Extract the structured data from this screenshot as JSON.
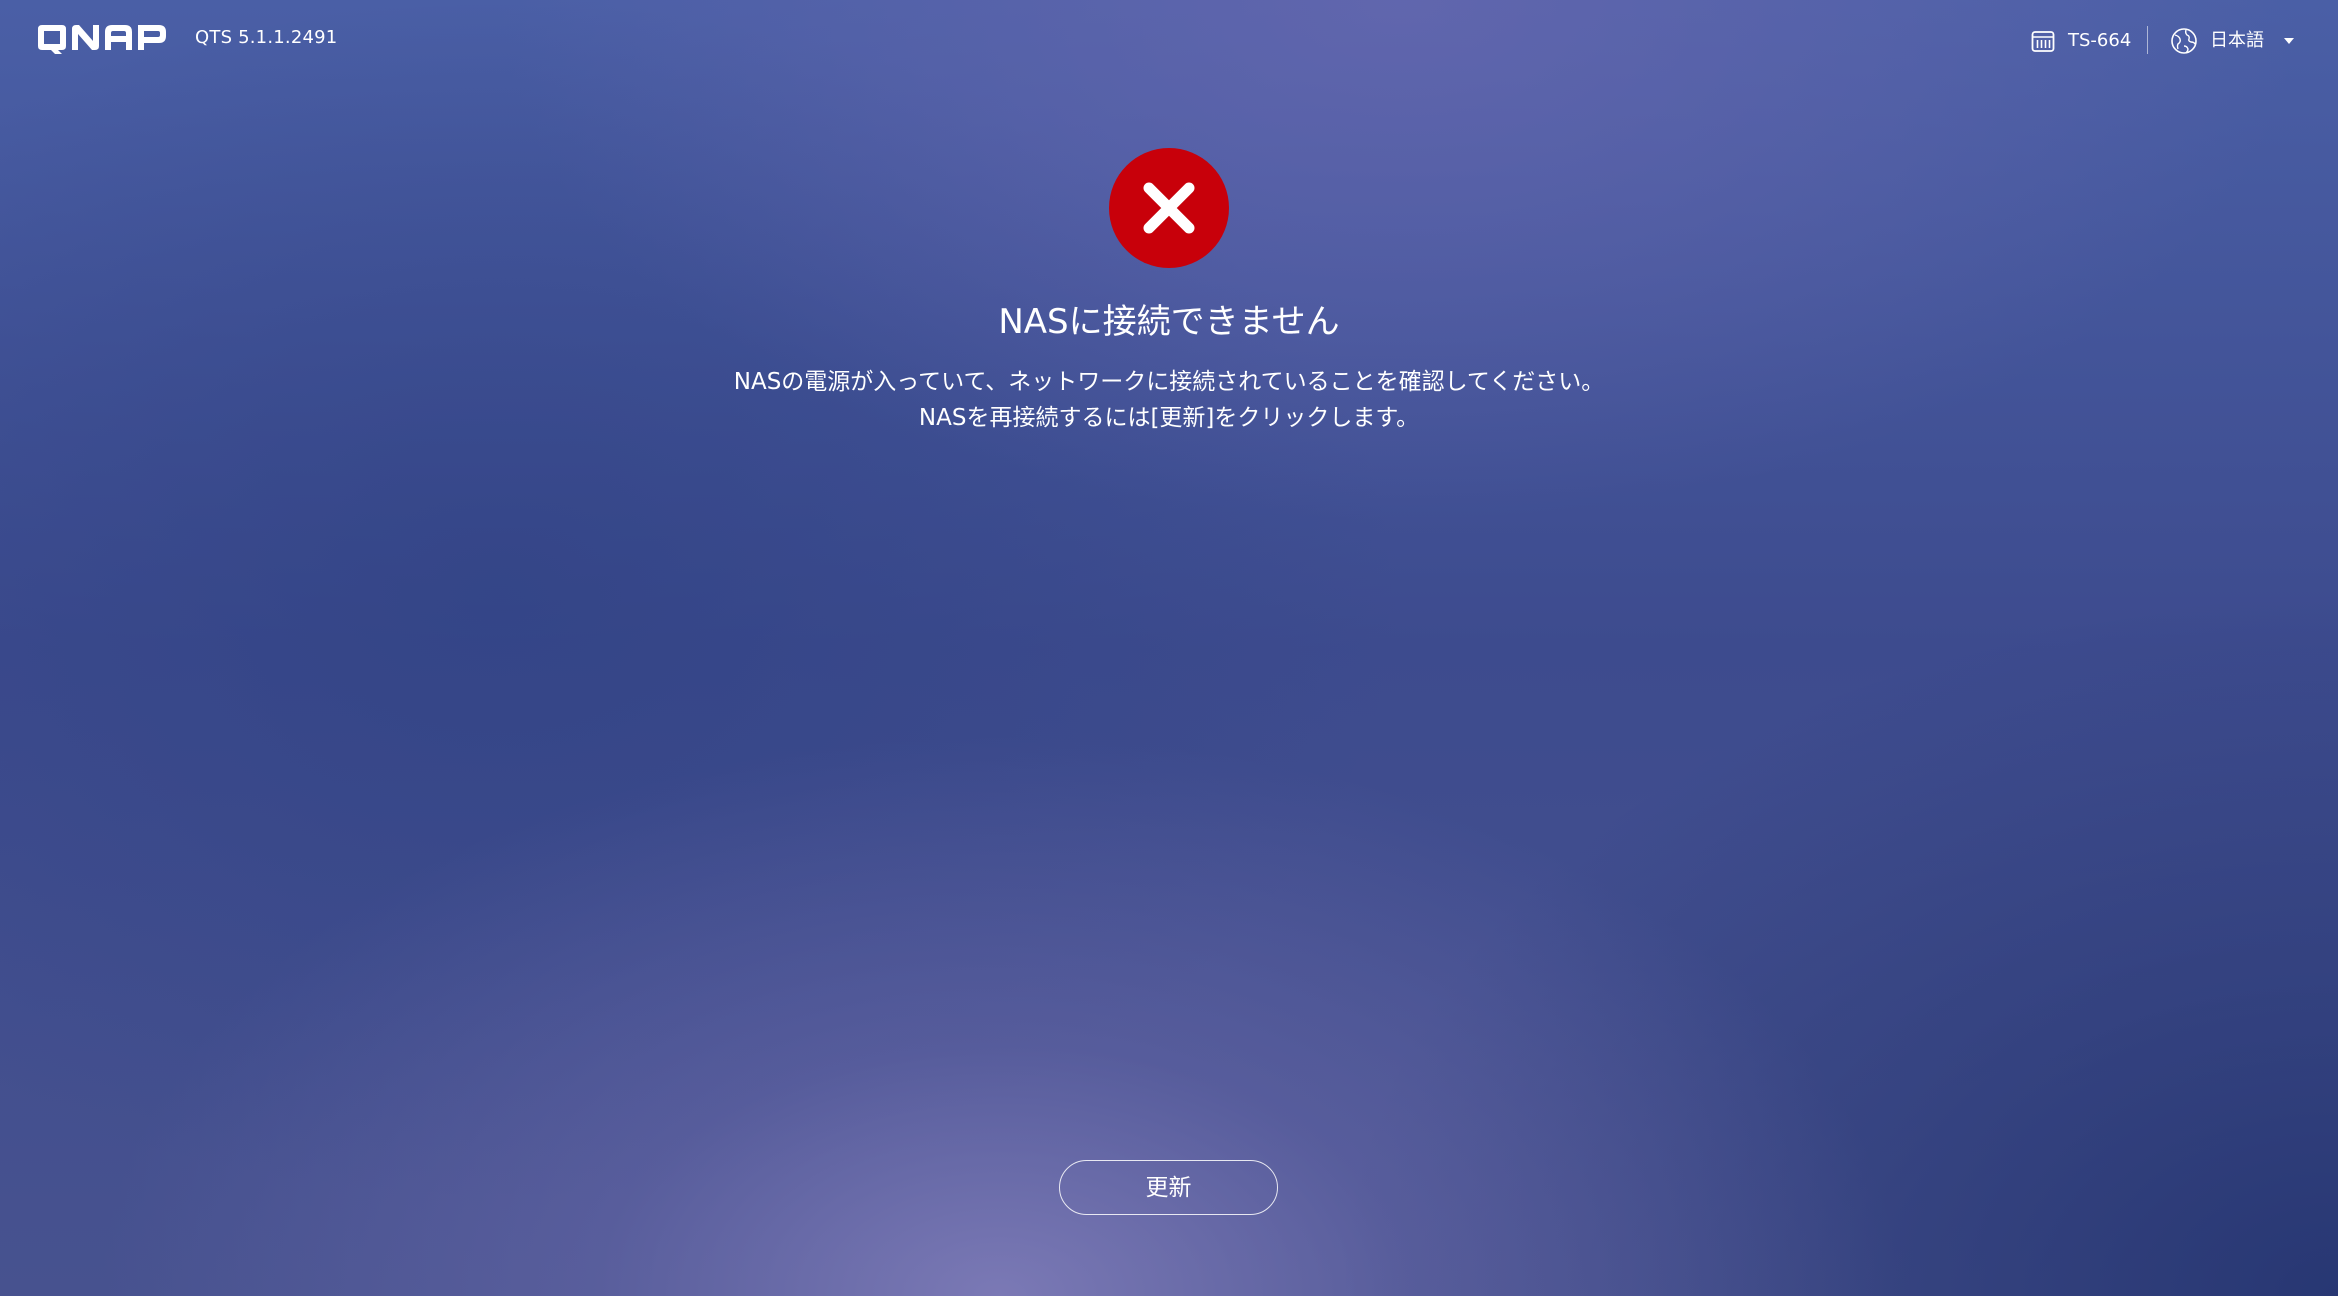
{
  "header": {
    "brand": "QNAP",
    "version": "QTS 5.1.1.2491",
    "device_name": "TS-664",
    "device_icon": "nas-device-icon",
    "language_icon": "globe-icon",
    "language_label": "日本語",
    "language_caret": "caret-down-icon"
  },
  "main": {
    "status_icon": "error-x-icon",
    "status_color": "#c8000a",
    "title": "NASに接続できません",
    "message_line1": "NASの電源が入っていて、ネットワークに接続されていることを確認してください。",
    "message_line2": "NASを再接続するには[更新]をクリックします。",
    "refresh_label": "更新"
  }
}
